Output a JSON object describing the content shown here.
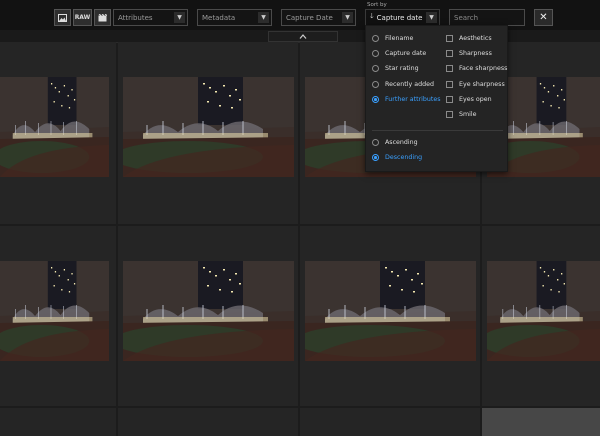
{
  "toolbar": {
    "filter_buttons": [
      {
        "icon": "image-icon"
      },
      {
        "label": "RAW"
      },
      {
        "icon": "video-icon"
      }
    ],
    "dropdowns": [
      {
        "label": "Attributes"
      },
      {
        "label": "Metadata"
      },
      {
        "label": "Capture Date"
      }
    ],
    "sort_label": "Sort by",
    "sort_value": "Capture date",
    "search_placeholder": "Search",
    "close_label": "✕"
  },
  "collapse_icon": "chevron-up-icon",
  "sort_menu": {
    "fields": [
      {
        "label": "Filename",
        "selected": false
      },
      {
        "label": "Capture date",
        "selected": false
      },
      {
        "label": "Star rating",
        "selected": false
      },
      {
        "label": "Recently added",
        "selected": false
      },
      {
        "label": "Further attributes",
        "selected": true
      }
    ],
    "attributes": [
      {
        "label": "Aesthetics",
        "checked": false
      },
      {
        "label": "Sharpness",
        "checked": false
      },
      {
        "label": "Face sharpness",
        "checked": false
      },
      {
        "label": "Eye sharpness",
        "checked": false
      },
      {
        "label": "Eyes open",
        "checked": false
      },
      {
        "label": "Smile",
        "checked": false
      }
    ],
    "order": [
      {
        "label": "Ascending",
        "selected": false
      },
      {
        "label": "Descending",
        "selected": true
      }
    ]
  },
  "colors": {
    "accent": "#3aa0ff",
    "background": "#1c1c1c",
    "toolbar": "#121212"
  }
}
